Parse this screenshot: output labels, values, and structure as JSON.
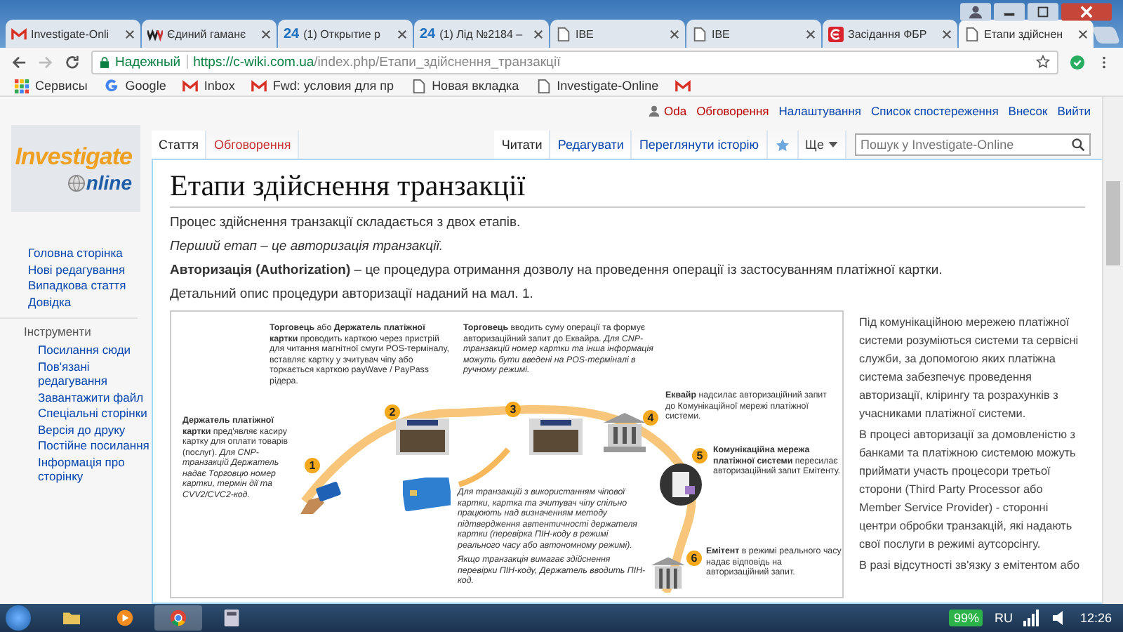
{
  "browser": {
    "tabs": [
      {
        "kind": "gmail",
        "title": "Investigate-Onli",
        "selected": false
      },
      {
        "kind": "wallet",
        "title": "Єдиний гаманє",
        "selected": false
      },
      {
        "kind": "news",
        "badge": "24",
        "title": "(1) Открытие р",
        "selected": false
      },
      {
        "kind": "news",
        "badge": "24",
        "title": "(1) Лід №2184 –",
        "selected": false
      },
      {
        "kind": "page",
        "title": "IBE",
        "selected": false
      },
      {
        "kind": "page",
        "title": "IBE",
        "selected": false
      },
      {
        "kind": "square-logo",
        "title": "Засідання ФБР",
        "selected": false
      },
      {
        "kind": "page",
        "title": "Етапи здійснен",
        "selected": true
      }
    ],
    "address": {
      "security": "Надежный",
      "url_host": "https://c-wiki.com.ua",
      "url_path": "/index.php/Етапи_здійснення_транзакції"
    },
    "bookmarks": [
      {
        "kind": "apps",
        "label": "Сервисы"
      },
      {
        "kind": "google",
        "label": "Google"
      },
      {
        "kind": "gmail",
        "label": "Inbox"
      },
      {
        "kind": "gmail",
        "label": "Fwd: условия для пр"
      },
      {
        "kind": "page",
        "label": "Новая вкладка"
      },
      {
        "kind": "page",
        "label": "Investigate-Online"
      },
      {
        "kind": "gmail"
      }
    ]
  },
  "wiki": {
    "logo": {
      "title": "Investigate",
      "subtitle": "nline"
    },
    "personal_links": [
      {
        "kind": "user",
        "label": "Oda",
        "missing": true
      },
      {
        "kind": "link",
        "label": "Обговорення",
        "missing": true
      },
      {
        "kind": "link",
        "label": "Налаштування",
        "missing": false
      },
      {
        "kind": "link",
        "label": "Список спостереження",
        "missing": false
      },
      {
        "kind": "link",
        "label": "Внесок",
        "missing": false
      },
      {
        "kind": "link",
        "label": "Вийти",
        "missing": false
      }
    ],
    "nav": [
      "Головна сторінка",
      "Нові редагування",
      "Випадкова стаття",
      "Довідка"
    ],
    "tools": {
      "heading": "Інструменти",
      "items": [
        "Посилання сюди",
        "Пов'язані редагування",
        "Завантажити файл",
        "Спеціальні сторінки",
        "Версія до друку",
        "Постійне посилання",
        "Інформація про сторінку"
      ]
    },
    "page_tabs": [
      {
        "label": "Стаття",
        "selected": true,
        "missing": false
      },
      {
        "label": "Обговорення",
        "selected": false,
        "missing": true
      }
    ],
    "view_tabs": [
      {
        "label": "Читати",
        "selected": true
      },
      {
        "label": "Редагувати",
        "selected": false
      },
      {
        "label": "Переглянути історію",
        "selected": false
      }
    ],
    "more": "Ще",
    "search": {
      "placeholder": "Пошук у Investigate-Online"
    },
    "title": "Етапи здійснення транзакції",
    "paragraphs": [
      {
        "text": "Процес здійснення транзакції складається з двох етапів.",
        "italic": false
      },
      {
        "text": "Перший етап – це авторизація транзакції.",
        "italic": true
      },
      {
        "text": "**Авторизація (Authorization)** – це процедура отримання дозволу на проведення операції із застосуванням платіжної картки.",
        "italic": false
      },
      {
        "text": "Детальний опис процедури авторизації наданий на мал. 1.",
        "italic": false
      }
    ],
    "figure": {
      "steps": [
        {
          "number": "1",
          "text": "**Держатель платіжної картки** пред'являє касиру картку для оплати товарів (послуг). *Для CNP-транзакцій Держатель надає Торговцю номер картки, термін дії та CVV2/CVC2-код.*"
        },
        {
          "number": "2",
          "text": "**Торговець** або **Держатель платіжної картки** проводить карткою через пристрій для читання магнітної смуги POS-терміналу, вставляє картку у зчитувач чіпу або торкається карткою payWave / PayPass рідера."
        },
        {
          "number": "3",
          "text": "**Торговець** вводить суму операції та формує авторизаційний запит до Еквайра. *Для CNP-транзакцій номер картки та інша інформація можуть бути введені на POS-терміналі в ручному режимі.*"
        },
        {
          "number": "4",
          "text": "**Еквайр** надсилає авторизаційний запит до Комунікаційної мережі платіжної системи."
        },
        {
          "number": "5",
          "text": "**Комунікаційна мережа платіжної системи** пересилає авторизаційний запит Емітенту."
        },
        {
          "number": "6",
          "text": "**Емітент** в режимі реального часу надає відповідь на авторизаційний запит."
        }
      ],
      "notes": [
        "Для транзакцій з використанням чіпової картки, картка та зчитувач чіпу спільно працюють над визначенням методу підтвердження автентичності держателя картки (перевірка ПІН-коду в режимі реального часу або автономному режимі).",
        "Якщо транзакція вимагає здійснення перевірки ПІН-коду, Держатель вводить ПІН-код."
      ]
    },
    "aside": [
      "Під комунікаційною мережею платіжної системи розуміються системи та сервісні служби, за допомогою яких платіжна система забезпечує проведення авторизації, клірингу та розрахунків з учасниками платіжної системи.",
      "В процесі авторизації за домовленістю з банками та платіжною системою можуть приймати участь процесори третьої сторони (Third Party Processor або Member Service Provider) - сторонні центри обробки транзакцій, які надають свої послуги в режимі аутсорсінгу.",
      "В разі відсутності зв'язку з емітентом або"
    ]
  },
  "taskbar": {
    "battery": "99%",
    "language": "RU",
    "time": "12:26"
  }
}
